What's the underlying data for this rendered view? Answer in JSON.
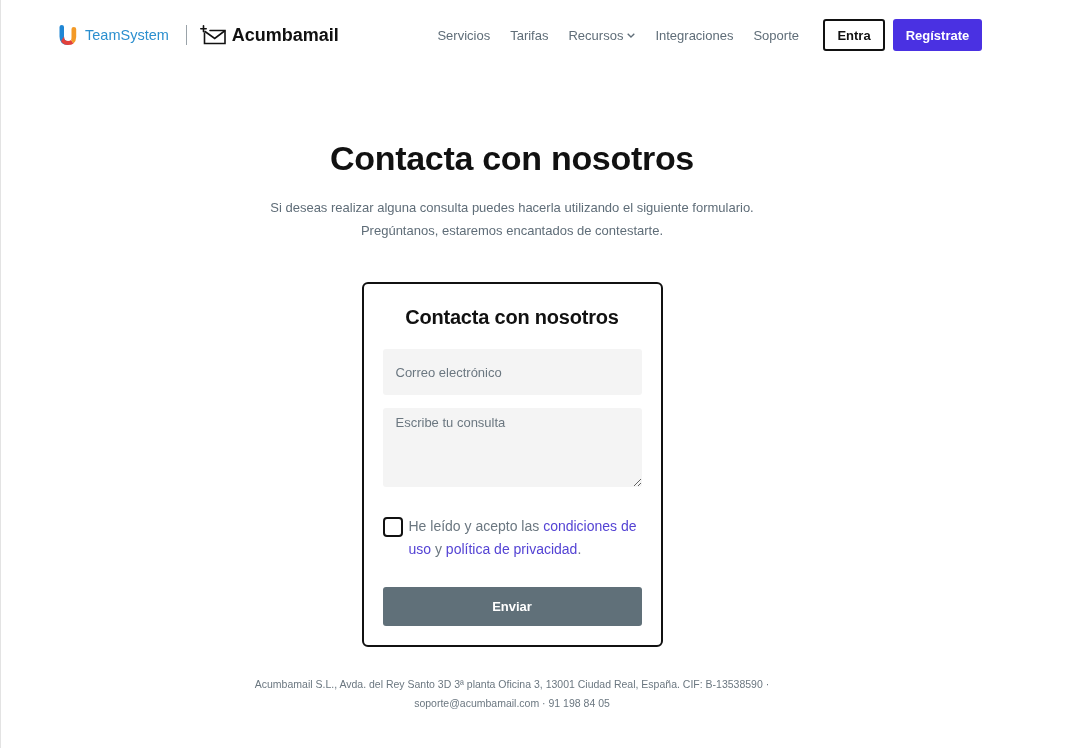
{
  "header": {
    "brand": {
      "partner": "TeamSystem",
      "product": "Acumbamail"
    },
    "nav": [
      {
        "label": "Servicios",
        "kind": "link"
      },
      {
        "label": "Tarifas",
        "kind": "link"
      },
      {
        "label": "Recursos",
        "kind": "dropdown"
      },
      {
        "label": "Integraciones",
        "kind": "link"
      },
      {
        "label": "Soporte",
        "kind": "link"
      }
    ],
    "buttons": [
      {
        "label": "Entra",
        "kind": "outline"
      },
      {
        "label": "Regístrate",
        "kind": "primary"
      }
    ]
  },
  "hero": {
    "title": "Contacta con nosotros",
    "lines": [
      "Si deseas realizar alguna consulta puedes hacerla utilizando el siguiente formulario.",
      "Pregúntanos, estaremos encantados de contestarte."
    ]
  },
  "form": {
    "title": "Contacta con nosotros",
    "fields": [
      {
        "kind": "input",
        "placeholder": "Correo electrónico"
      },
      {
        "kind": "textarea",
        "placeholder": "Escribe tu consulta"
      }
    ],
    "consent": {
      "checked": false,
      "parts": [
        {
          "kind": "text",
          "text": "He leído y acepto las"
        },
        {
          "kind": "link",
          "text": "condiciones de"
        },
        {
          "kind": "link",
          "text": "uso"
        },
        {
          "kind": "text",
          "text": "y"
        },
        {
          "kind": "link",
          "text": "política de privacidad"
        },
        {
          "kind": "punct",
          "text": "."
        }
      ]
    },
    "submit": "Enviar"
  },
  "footer": {
    "lines": [
      "Acumbamail S.L., Avda. del Rey Santo 3D 3ª planta Oficina 3, 13001 Ciudad Real, España. CIF: B-13538590 ·",
      "soporte@acumbamail.com · 91 198 84 05"
    ]
  }
}
